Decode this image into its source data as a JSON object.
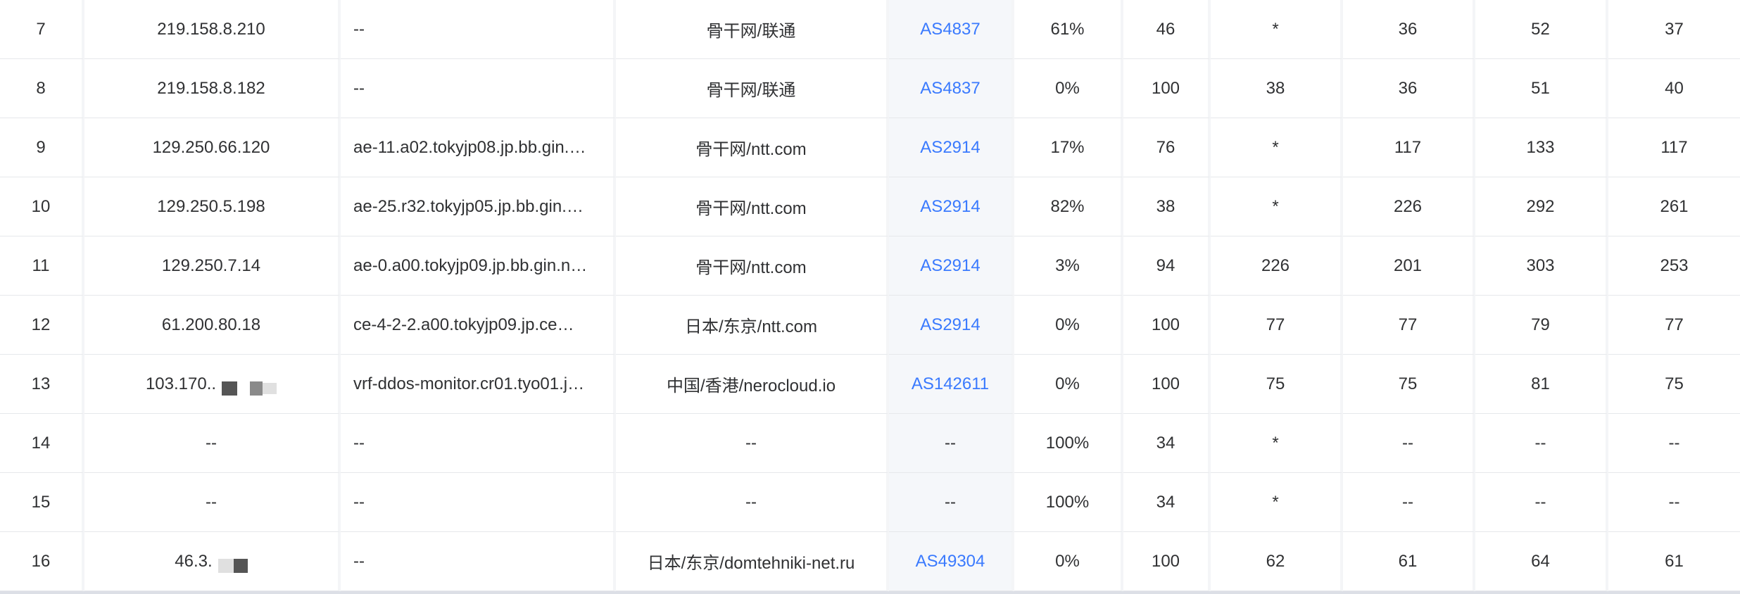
{
  "colors": {
    "link": "#3a7afe",
    "asn_bg": "#f5f7fa",
    "border": "#e6e8eb"
  },
  "rows": [
    {
      "hop": "7",
      "ip": "219.158.8.210",
      "ip_masked": false,
      "host": "--",
      "location": "骨干网/联通",
      "asn": "AS4837",
      "loss": "61%",
      "sent": "46",
      "last": "*",
      "best": "36",
      "worst": "52",
      "avg": "37"
    },
    {
      "hop": "8",
      "ip": "219.158.8.182",
      "ip_masked": false,
      "host": "--",
      "location": "骨干网/联通",
      "asn": "AS4837",
      "loss": "0%",
      "sent": "100",
      "last": "38",
      "best": "36",
      "worst": "51",
      "avg": "40"
    },
    {
      "hop": "9",
      "ip": "129.250.66.120",
      "ip_masked": false,
      "host": "ae-11.a02.tokyjp08.jp.bb.gin.…",
      "location": "骨干网/ntt.com",
      "asn": "AS2914",
      "loss": "17%",
      "sent": "76",
      "last": "*",
      "best": "117",
      "worst": "133",
      "avg": "117"
    },
    {
      "hop": "10",
      "ip": "129.250.5.198",
      "ip_masked": false,
      "host": "ae-25.r32.tokyjp05.jp.bb.gin.…",
      "location": "骨干网/ntt.com",
      "asn": "AS2914",
      "loss": "82%",
      "sent": "38",
      "last": "*",
      "best": "226",
      "worst": "292",
      "avg": "261"
    },
    {
      "hop": "11",
      "ip": "129.250.7.14",
      "ip_masked": false,
      "host": "ae-0.a00.tokyjp09.jp.bb.gin.n…",
      "location": "骨干网/ntt.com",
      "asn": "AS2914",
      "loss": "3%",
      "sent": "94",
      "last": "226",
      "best": "201",
      "worst": "303",
      "avg": "253"
    },
    {
      "hop": "12",
      "ip": "61.200.80.18",
      "ip_masked": false,
      "host": "ce-4-2-2.a00.tokyjp09.jp.ce…",
      "location": "日本/东京/ntt.com",
      "asn": "AS2914",
      "loss": "0%",
      "sent": "100",
      "last": "77",
      "best": "77",
      "worst": "79",
      "avg": "77"
    },
    {
      "hop": "13",
      "ip": "103.170..",
      "ip_masked": true,
      "host": "vrf-ddos-monitor.cr01.tyo01.j…",
      "location": "中国/香港/nerocloud.io",
      "asn": "AS142611",
      "loss": "0%",
      "sent": "100",
      "last": "75",
      "best": "75",
      "worst": "81",
      "avg": "75"
    },
    {
      "hop": "14",
      "ip": "--",
      "ip_masked": false,
      "host": "--",
      "location": "--",
      "asn": "--",
      "loss": "100%",
      "sent": "34",
      "last": "*",
      "best": "--",
      "worst": "--",
      "avg": "--"
    },
    {
      "hop": "15",
      "ip": "--",
      "ip_masked": false,
      "host": "--",
      "location": "--",
      "asn": "--",
      "loss": "100%",
      "sent": "34",
      "last": "*",
      "best": "--",
      "worst": "--",
      "avg": "--"
    },
    {
      "hop": "16",
      "ip": "46.3.",
      "ip_masked": true,
      "host": "--",
      "location": "日本/东京/domtehniki-net.ru",
      "asn": "AS49304",
      "loss": "0%",
      "sent": "100",
      "last": "62",
      "best": "61",
      "worst": "64",
      "avg": "61"
    }
  ]
}
